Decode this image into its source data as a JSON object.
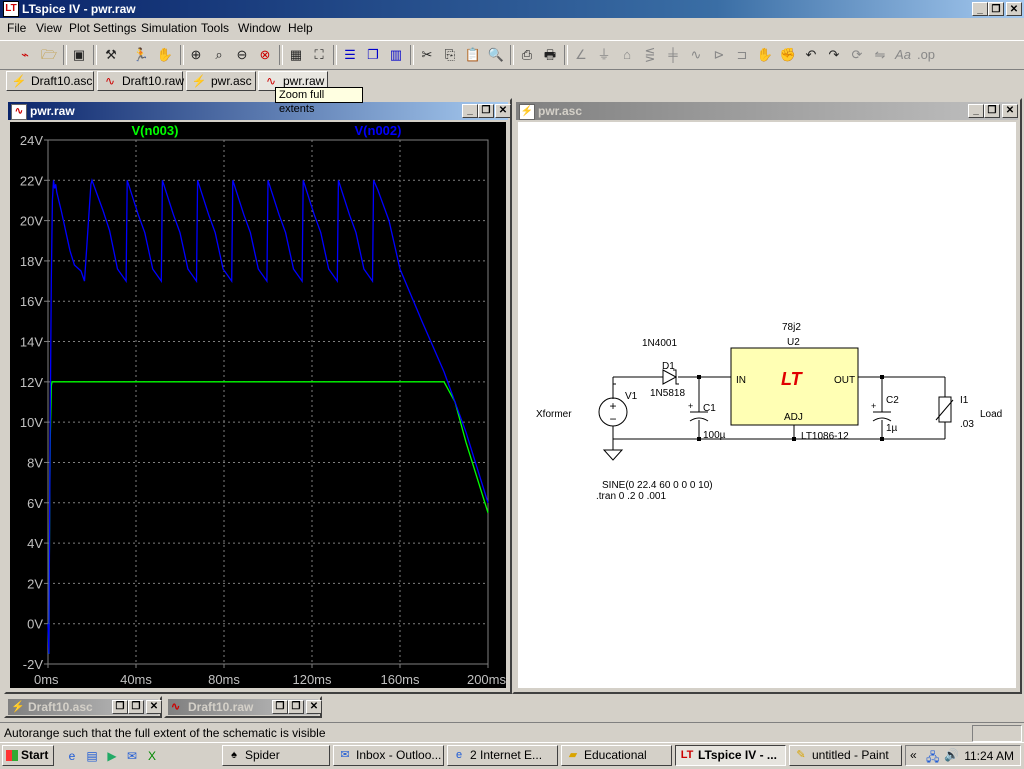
{
  "app": {
    "title": "LTspice IV - pwr.raw",
    "icon": "ltspice-icon"
  },
  "window_controls": {
    "minimize": "_",
    "restore": "❐",
    "close": "✕"
  },
  "menu": [
    "File",
    "View",
    "Plot Settings",
    "Simulation",
    "Tools",
    "Window",
    "Help"
  ],
  "toolbar": {
    "groups": [
      [
        "new-schematic-icon",
        "open-icon"
      ],
      [
        "save-icon"
      ],
      [
        "control-panel-icon",
        "run-icon",
        "pan-icon"
      ],
      [
        "zoom-in-icon",
        "zoom-area-icon",
        "zoom-out-icon",
        "zoom-fit-icon"
      ],
      [
        "autorange-icon",
        "zoom-full-icon"
      ],
      [
        "tile-horizontal-icon",
        "cascade-icon",
        "tile-vertical-icon"
      ],
      [
        "cut-icon",
        "copy-icon",
        "paste-icon",
        "find-icon"
      ],
      [
        "print-preview-icon",
        "print-icon"
      ],
      [
        "wire-icon",
        "ground-icon",
        "label-icon",
        "resistor-icon",
        "capacitor-icon",
        "inductor-icon",
        "diode-icon",
        "component-icon",
        "move-icon",
        "drag-icon",
        "undo-icon",
        "redo-icon",
        "rotate-icon",
        "mirror-icon",
        "text-icon",
        "spice-directive-icon"
      ]
    ]
  },
  "tabs": [
    {
      "label": "Draft10.asc",
      "icon": "schematic-icon"
    },
    {
      "label": "Draft10.raw",
      "icon": "waveform-icon"
    },
    {
      "label": "pwr.asc",
      "icon": "schematic-icon"
    },
    {
      "label": "pwr.raw",
      "icon": "waveform-icon",
      "active": true
    }
  ],
  "tooltip": "Zoom full extents",
  "plot_window": {
    "title": "pwr.raw"
  },
  "schematic_window": {
    "title": "pwr.asc"
  },
  "chart_data": {
    "type": "line",
    "series": [
      {
        "name": "V(n003)",
        "color": "#00ff00",
        "x": [
          0,
          0.4,
          0.6,
          1,
          1.5,
          1.8,
          2,
          3,
          5,
          10,
          20,
          40,
          60,
          80,
          100,
          120,
          140,
          160,
          170,
          179,
          180,
          185,
          190,
          200
        ],
        "y": [
          0,
          -1.5,
          3,
          9,
          11.8,
          12,
          12,
          12,
          12,
          12,
          12,
          12,
          12,
          12,
          12,
          12,
          12,
          12,
          12,
          12,
          12,
          11,
          9,
          5.5
        ]
      },
      {
        "name": "V(n002)",
        "color": "#0000ff",
        "x": [
          0,
          0.4,
          0.6,
          1,
          1.5,
          2,
          2.5,
          3,
          3.5,
          4,
          6,
          8,
          10,
          12,
          15,
          16.6,
          19.5,
          20,
          25,
          28,
          31.6,
          35.5,
          36,
          41,
          44,
          47.6,
          51.5,
          52,
          57,
          60,
          63.6,
          67.5,
          68,
          73,
          76,
          79.6,
          83.5,
          84,
          89,
          92,
          95.6,
          99.5,
          100,
          105,
          108,
          111.6,
          115.5,
          116,
          121,
          124,
          127.6,
          131.5,
          132,
          137,
          140,
          143.6,
          147.5,
          148,
          150,
          155,
          160,
          170,
          180,
          190,
          200
        ],
        "y": [
          0,
          -1.5,
          2.5,
          10,
          17,
          21,
          22,
          21.6,
          21.8,
          21.4,
          20.5,
          19.5,
          18.5,
          17.8,
          17.5,
          17,
          21.8,
          22,
          20.5,
          19.5,
          17.6,
          17,
          22,
          20.3,
          19.4,
          17.6,
          17,
          22,
          20.3,
          19.4,
          17.6,
          17,
          22,
          20.3,
          19.4,
          17.6,
          17,
          22,
          20.3,
          19.4,
          17.6,
          17,
          22,
          20.3,
          19.4,
          17.6,
          17,
          22,
          20.3,
          19.4,
          17.6,
          17,
          22,
          20.3,
          19.4,
          17.6,
          17,
          22,
          21.5,
          20,
          17.6,
          15,
          12.5,
          9.5,
          6
        ]
      }
    ],
    "xlabel": "",
    "ylabel": "",
    "xlim": [
      0,
      200
    ],
    "ylim": [
      -2,
      24
    ],
    "x_ticks": [
      0,
      40,
      80,
      120,
      160,
      200
    ],
    "x_tick_labels": [
      "0ms",
      "40ms",
      "80ms",
      "120ms",
      "160ms",
      "200ms"
    ],
    "y_ticks": [
      -2,
      0,
      2,
      4,
      6,
      8,
      10,
      12,
      14,
      16,
      18,
      20,
      22,
      24
    ],
    "y_tick_labels": [
      "-2V",
      "0V",
      "2V",
      "4V",
      "6V",
      "8V",
      "10V",
      "12V",
      "14V",
      "16V",
      "18V",
      "20V",
      "22V",
      "24V"
    ],
    "grid": true,
    "background": "#000000",
    "grid_color": "#808080",
    "axis_label_color": "#c0c0c0"
  },
  "schematic": {
    "labels": {
      "d1_model": "1N4001",
      "d1_ref": "D1",
      "d1_value": "1N5818",
      "u2_model": "78j2",
      "u2_ref": "U2",
      "u2_part": "LT1086-12",
      "pin_in": "IN",
      "pin_out": "OUT",
      "pin_adj": "ADJ",
      "v1_ref": "V1",
      "xformer": "Xformer",
      "c1_ref": "C1",
      "c1_value": "100µ",
      "c2_ref": "C2",
      "c2_value": "1µ",
      "i1_ref": "I1",
      "i1_value": ".03",
      "load": "Load",
      "sine": "SINE(0 22.4 60 0 0 0 10)",
      "tran": ".tran 0 .2 0 .001"
    },
    "logo_color": "#e00000",
    "chip_fill": "#ffffb4"
  },
  "minimized_windows": [
    {
      "label": "Draft10.asc",
      "icon": "schematic-icon"
    },
    {
      "label": "Draft10.raw",
      "icon": "waveform-icon"
    }
  ],
  "status": {
    "text": "Autorange such that the full extent of the schematic is visible"
  },
  "taskbar": {
    "start": "Start",
    "quick_launch": [
      "ie-icon",
      "desktop-icon",
      "media-icon",
      "outlook-icon",
      "excel-icon"
    ],
    "tasks": [
      {
        "label": "Spider",
        "icon": "spider-icon"
      },
      {
        "label": "Inbox - Outloo...",
        "icon": "outlook-icon"
      },
      {
        "label": "2 Internet E...",
        "icon": "ie-icon"
      },
      {
        "label": "Educational",
        "icon": "folder-icon"
      },
      {
        "label": "LTspice IV - ...",
        "icon": "ltspice-icon",
        "active": true
      },
      {
        "label": "untitled - Paint",
        "icon": "paint-icon"
      }
    ],
    "tray_chevron": "«",
    "clock": "11:24 AM"
  }
}
